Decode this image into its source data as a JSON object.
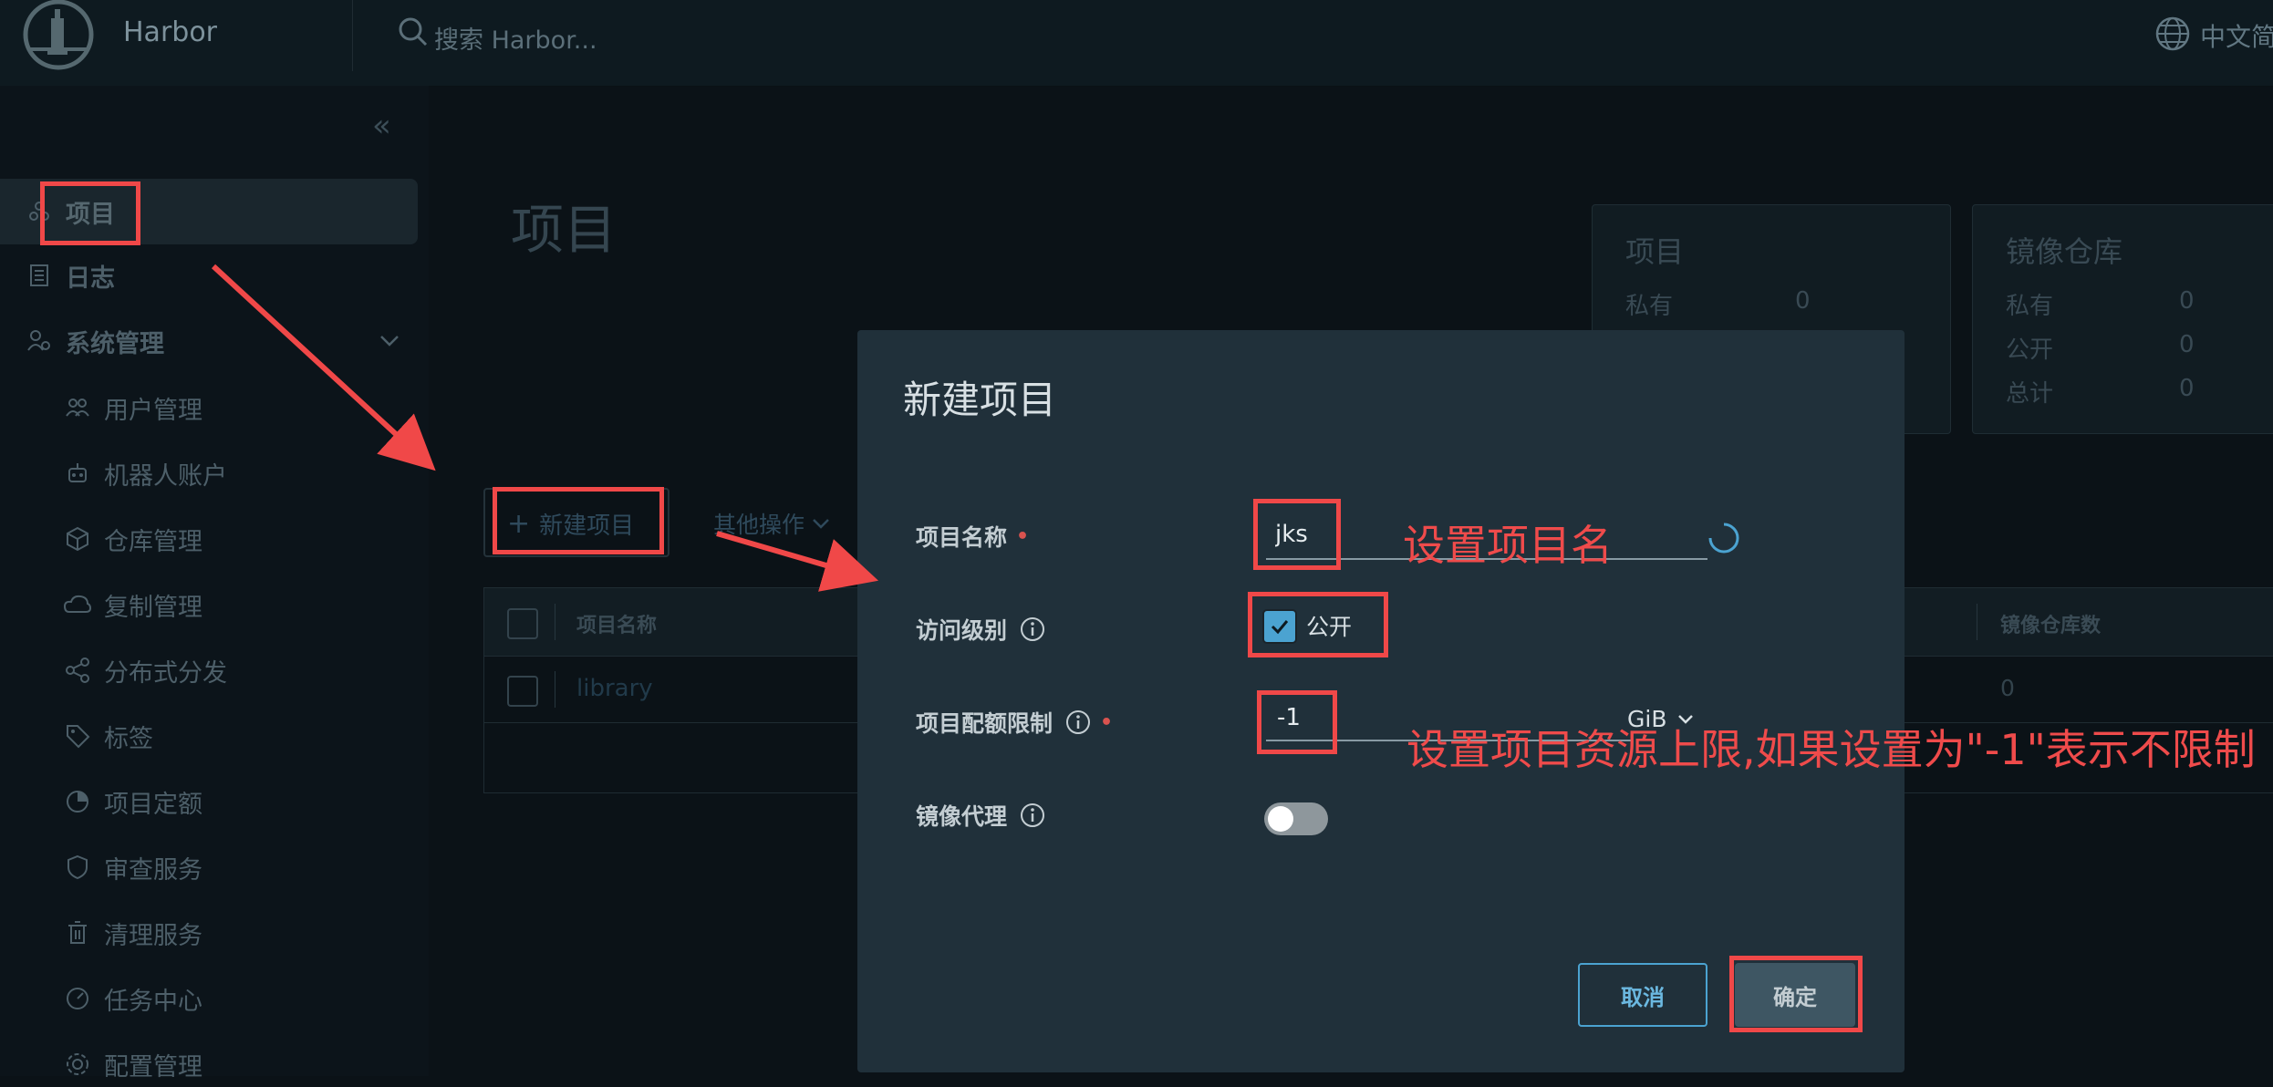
{
  "header": {
    "brand": "Harbor",
    "search_placeholder": "搜索 Harbor...",
    "language": "中文简"
  },
  "sidebar": {
    "collapse_icon": "«",
    "items": [
      {
        "label": "项目",
        "icon": "projects-icon",
        "active": true
      },
      {
        "label": "日志",
        "icon": "log-icon"
      },
      {
        "label": "系统管理",
        "icon": "admin-icon"
      },
      {
        "label": "用户管理",
        "icon": "users-icon"
      },
      {
        "label": "机器人账户",
        "icon": "robot-icon"
      },
      {
        "label": "仓库管理",
        "icon": "registry-icon"
      },
      {
        "label": "复制管理",
        "icon": "replication-icon"
      },
      {
        "label": "分布式分发",
        "icon": "distribution-icon"
      },
      {
        "label": "标签",
        "icon": "tag-icon"
      },
      {
        "label": "项目定额",
        "icon": "quota-icon"
      },
      {
        "label": "审查服务",
        "icon": "scan-icon"
      },
      {
        "label": "清理服务",
        "icon": "trash-icon"
      },
      {
        "label": "任务中心",
        "icon": "dashboard-icon"
      },
      {
        "label": "配置管理",
        "icon": "gear-icon"
      }
    ]
  },
  "main": {
    "title": "项目",
    "summary_projects": {
      "title": "项目",
      "private_label": "私有",
      "private_value": "0"
    },
    "summary_repos": {
      "title": "镜像仓库",
      "private_label": "私有",
      "private_value": "0",
      "public_label": "公开",
      "public_value": "0",
      "total_label": "总计",
      "total_value": "0"
    },
    "new_project_button": "新建项目",
    "other_actions": "其他操作",
    "table": {
      "col_name": "项目名称",
      "col_repo_count": "镜像仓库数",
      "row": {
        "name": "library",
        "repo_count": "0"
      }
    }
  },
  "modal": {
    "title": "新建项目",
    "name_label": "项目名称",
    "name_value": "jks",
    "access_label": "访问级别",
    "public_label": "公开",
    "public_checked": true,
    "quota_label": "项目配额限制",
    "quota_value": "-1",
    "quota_unit": "GiB",
    "proxy_label": "镜像代理",
    "proxy_enabled": false,
    "cancel": "取消",
    "ok": "确定"
  },
  "annotations": {
    "set_name": "设置项目名",
    "set_quota": "设置项目资源上限,如果设置为\"-1\"表示不限制"
  },
  "colors": {
    "annotation_red": "#f04848",
    "accent_blue": "#4ba3d1",
    "modal_bg": "#20303a"
  }
}
